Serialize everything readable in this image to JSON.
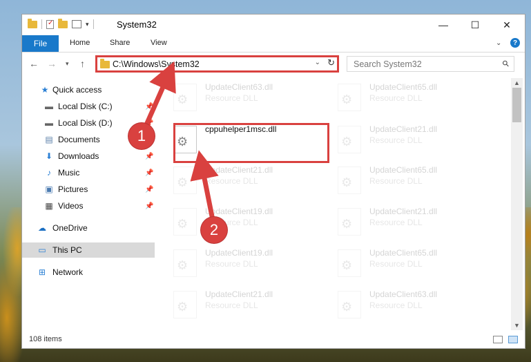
{
  "window": {
    "title": "System32",
    "controls": {
      "minimize": "—",
      "maximize": "☐",
      "close": "✕"
    }
  },
  "ribbon": {
    "tabs": [
      {
        "label": "File"
      },
      {
        "label": "Home"
      },
      {
        "label": "Share"
      },
      {
        "label": "View"
      }
    ],
    "help": "?"
  },
  "nav": {
    "address": "C:\\Windows\\System32",
    "search_placeholder": "Search System32"
  },
  "sidebar": {
    "items": [
      {
        "label": "Quick access",
        "icon": "star-icon",
        "pinned": false
      },
      {
        "label": "Local Disk (C:)",
        "icon": "drive-icon",
        "pinned": true
      },
      {
        "label": "Local Disk (D:)",
        "icon": "drive-icon",
        "pinned": true
      },
      {
        "label": "Documents",
        "icon": "documents-icon",
        "pinned": true
      },
      {
        "label": "Downloads",
        "icon": "download-icon",
        "pinned": true
      },
      {
        "label": "Music",
        "icon": "music-icon",
        "pinned": true
      },
      {
        "label": "Pictures",
        "icon": "pictures-icon",
        "pinned": true
      },
      {
        "label": "Videos",
        "icon": "videos-icon",
        "pinned": true
      },
      {
        "label": "OneDrive",
        "icon": "cloud-icon",
        "pinned": false
      },
      {
        "label": "This PC",
        "icon": "computer-icon",
        "pinned": false,
        "selected": true
      },
      {
        "label": "Network",
        "icon": "network-icon",
        "pinned": false
      }
    ]
  },
  "files": [
    {
      "name": "UpdateClient63.dll",
      "type": "Resource DLL",
      "faded": true
    },
    {
      "name": "UpdateClient65.dll",
      "type": "Resource DLL",
      "faded": true
    },
    {
      "name": "cppuhelper1msc.dll",
      "type": "",
      "faded": false
    },
    {
      "name": "UpdateClient21.dll",
      "type": "Resource DLL",
      "faded": true
    },
    {
      "name": "UpdateClient21.dll",
      "type": "Resource DLL",
      "faded": true
    },
    {
      "name": "UpdateClient65.dll",
      "type": "Resource DLL",
      "faded": true
    },
    {
      "name": "UpdateClient19.dll",
      "type": "Resource DLL",
      "faded": true
    },
    {
      "name": "UpdateClient21.dll",
      "type": "Resource DLL",
      "faded": true
    },
    {
      "name": "UpdateClient19.dll",
      "type": "Resource DLL",
      "faded": true
    },
    {
      "name": "UpdateClient65.dll",
      "type": "Resource DLL",
      "faded": true
    },
    {
      "name": "UpdateClient21.dll",
      "type": "Resource DLL",
      "faded": true
    },
    {
      "name": "UpdateClient63.dll",
      "type": "Resource DLL",
      "faded": true
    }
  ],
  "status": {
    "count": "108 items"
  },
  "annotations": {
    "step1": "1",
    "step2": "2",
    "color": "#d9413f"
  }
}
